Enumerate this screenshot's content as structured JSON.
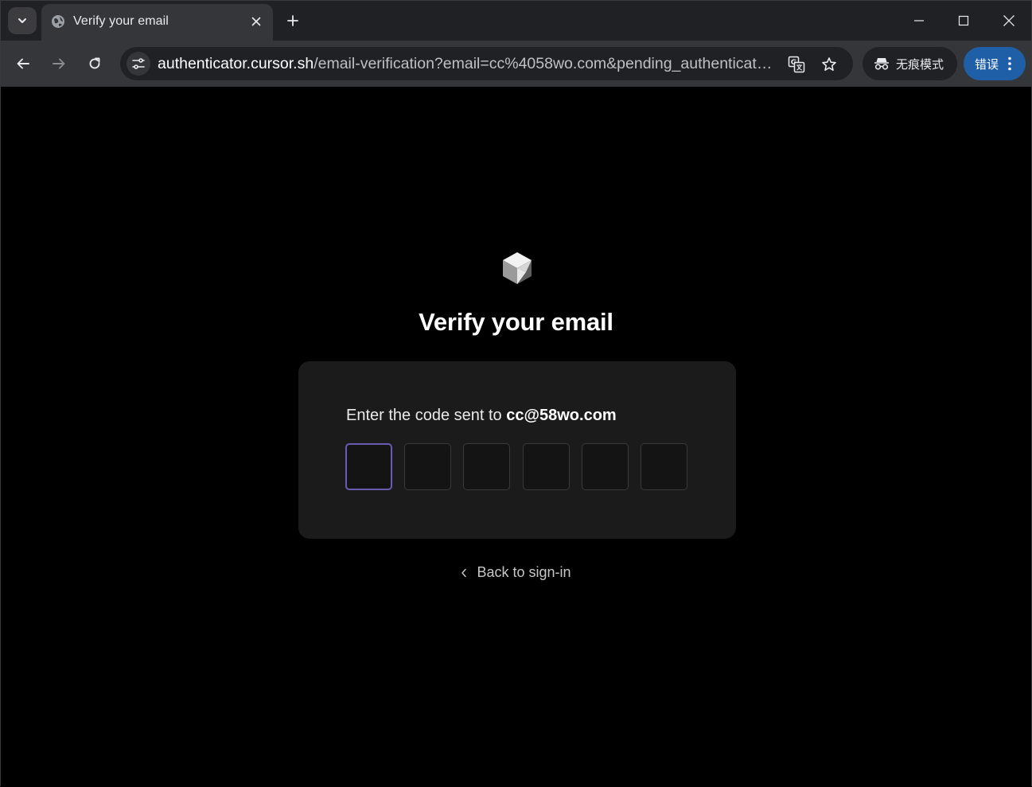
{
  "browser": {
    "tab": {
      "title": "Verify your email"
    },
    "url": {
      "host": "authenticator.cursor.sh",
      "rest": "/email-verification?email=cc%4058wo.com&pending_authenticatio..."
    },
    "incognito_label": "无痕模式",
    "error_label": "错误",
    "icons": {
      "tab_search": "chevron-down-icon",
      "favicon": "globe-icon",
      "close_tab": "close-icon",
      "new_tab": "plus-icon",
      "back": "arrow-left-icon",
      "forward": "arrow-right-icon",
      "reload": "reload-icon",
      "site_info": "tune-icon",
      "translate": "translate-icon",
      "bookmark": "star-icon",
      "incognito": "incognito-icon",
      "menu": "more-vert-icon"
    },
    "colors": {
      "error_chip": "#1f5fa8"
    }
  },
  "page": {
    "logo": "cursor-cube-logo",
    "title": "Verify your email",
    "prompt_prefix": "Enter the code sent to",
    "prompt_email": "cc@58wo.com",
    "code_digits": [
      "",
      "",
      "",
      "",
      "",
      ""
    ],
    "back_link": "Back to sign-in",
    "colors": {
      "background": "#000000",
      "card": "#1b1b1c",
      "active_focus": "#6b5bb0"
    }
  }
}
